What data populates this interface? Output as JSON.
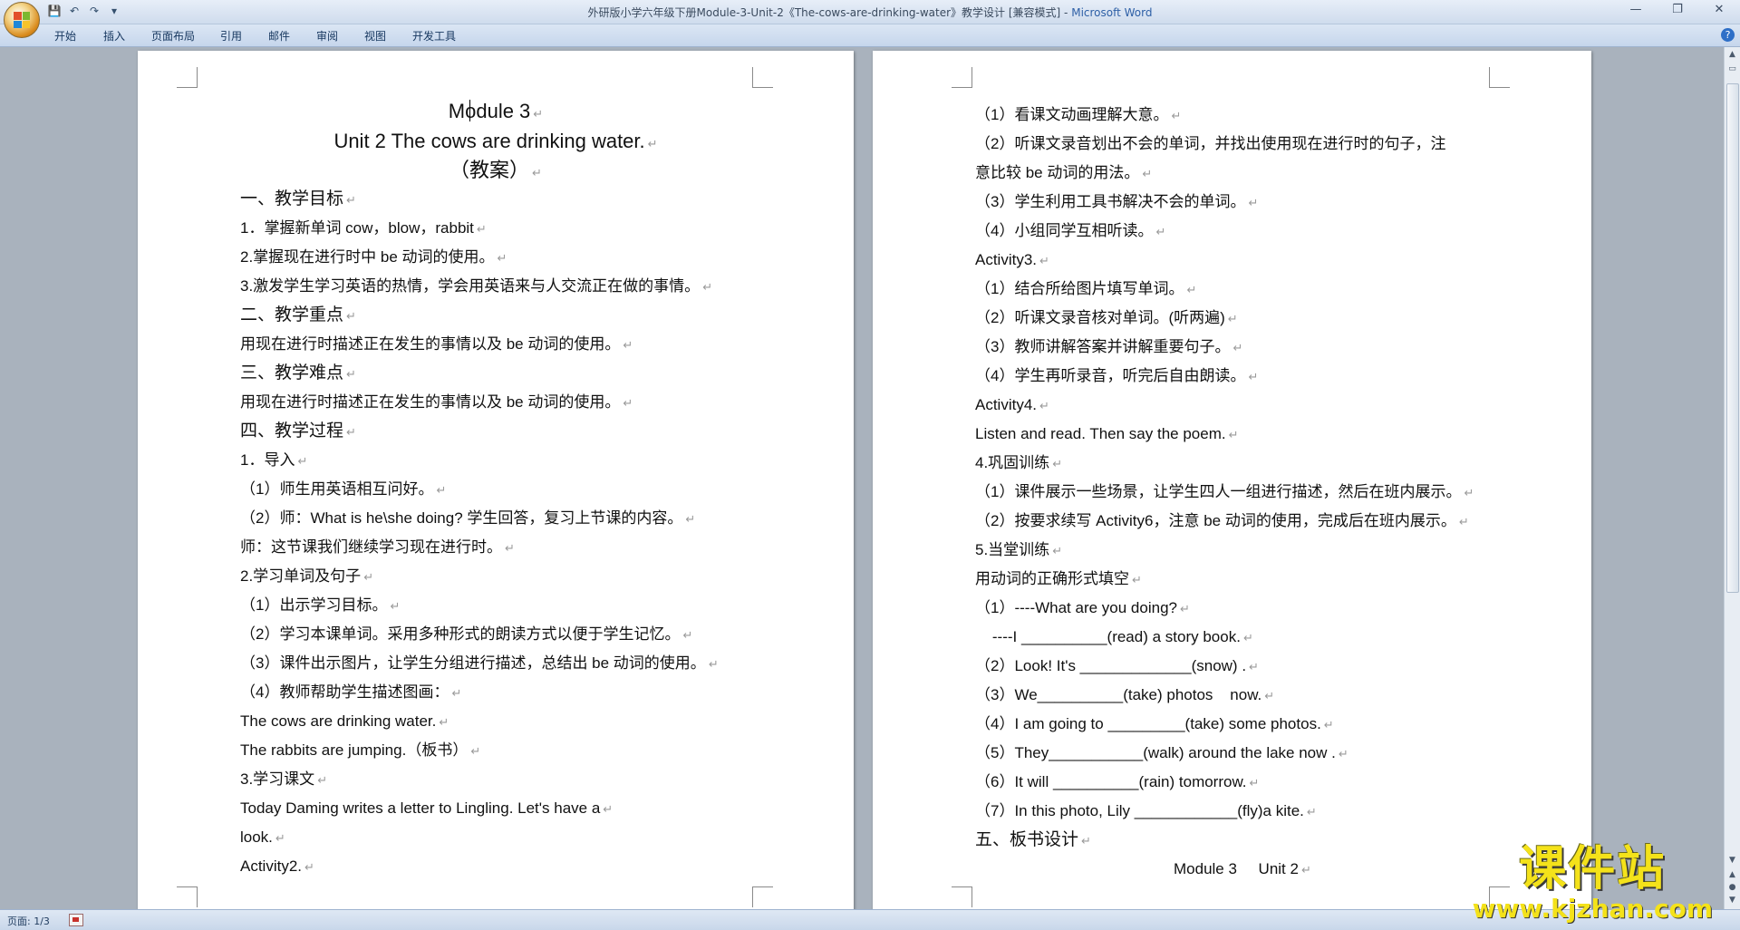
{
  "window": {
    "title": "外研版小学六年级下册Module-3-Unit-2《The-cows-are-drinking-water》教学设计 [兼容模式] -",
    "app_name": "Microsoft Word",
    "minimize": "—",
    "maximize": "❐",
    "close": "✕"
  },
  "quick_access": {
    "save": "💾",
    "undo": "↶",
    "redo": "↷",
    "customize": "▾"
  },
  "ribbon": {
    "tabs": [
      "开始",
      "插入",
      "页面布局",
      "引用",
      "邮件",
      "审阅",
      "视图",
      "开发工具"
    ]
  },
  "help": "?",
  "paragraph_mark": "↵",
  "left_page": [
    "Module 3",
    "Unit 2 The cows are drinking water.",
    "（教案）",
    "一、教学目标",
    "1．掌握新单词 cow，blow，rabbit",
    "2.掌握现在进行时中 be 动词的使用。",
    "3.激发学生学习英语的热情，学会用英语来与人交流正在做的事情。",
    "二、教学重点",
    "用现在进行时描述正在发生的事情以及 be 动词的使用。",
    "三、教学难点",
    "用现在进行时描述正在发生的事情以及 be 动词的使用。",
    "四、教学过程",
    "1．导入",
    "（1）师生用英语相互问好。",
    "（2）师：What is he\\she doing?  学生回答，复习上节课的内容。",
    "师：这节课我们继续学习现在进行时。",
    "2.学习单词及句子",
    "（1）出示学习目标。",
    "（2）学习本课单词。采用多种形式的朗读方式以便于学生记忆。",
    "（3）课件出示图片，让学生分组进行描述，总结出 be 动词的使用。",
    "（4）教师帮助学生描述图画：",
    "The cows are drinking water.",
    "The rabbits are jumping.（板书）",
    "3.学习课文",
    "Today Daming writes a letter to Lingling. Let's have a",
    "look.",
    "Activity2."
  ],
  "right_page": [
    "（1）看课文动画理解大意。",
    "（2）听课文录音划出不会的单词，并找出使用现在进行时的句子，注",
    "意比较 be 动词的用法。",
    "（3）学生利用工具书解决不会的单词。",
    "（4）小组同学互相听读。",
    "Activity3.",
    "（1）结合所给图片填写单词。",
    "（2）听课文录音核对单词。(听两遍)",
    "（3）教师讲解答案并讲解重要句子。",
    "（4）学生再听录音，听完后自由朗读。",
    "Activity4.",
    " Listen and read. Then say the poem.",
    "4.巩固训练",
    "（1）课件展示一些场景，让学生四人一组进行描述，然后在班内展示。",
    "（2）按要求续写 Activity6，注意 be 动词的使用，完成后在班内展示。",
    "5.当堂训练",
    "用动词的正确形式填空",
    "（1）----What are you doing?",
    "    ----I __________(read) a story book.",
    "（2）Look! It's _____________(snow) .",
    "（3）We__________(take) photos    now.",
    "（4）I am going to _________(take) some photos.",
    "（5）They___________(walk) around the lake now .",
    "（6）It will __________(rain) tomorrow.",
    "（7）In this photo, Lily ____________(fly)a kite.",
    "五、板书设计",
    "Module 3     Unit 2"
  ],
  "status": {
    "page": "页面: 1/3"
  },
  "watermark": {
    "text": "课件站",
    "url": "www.kjzhan.com"
  }
}
